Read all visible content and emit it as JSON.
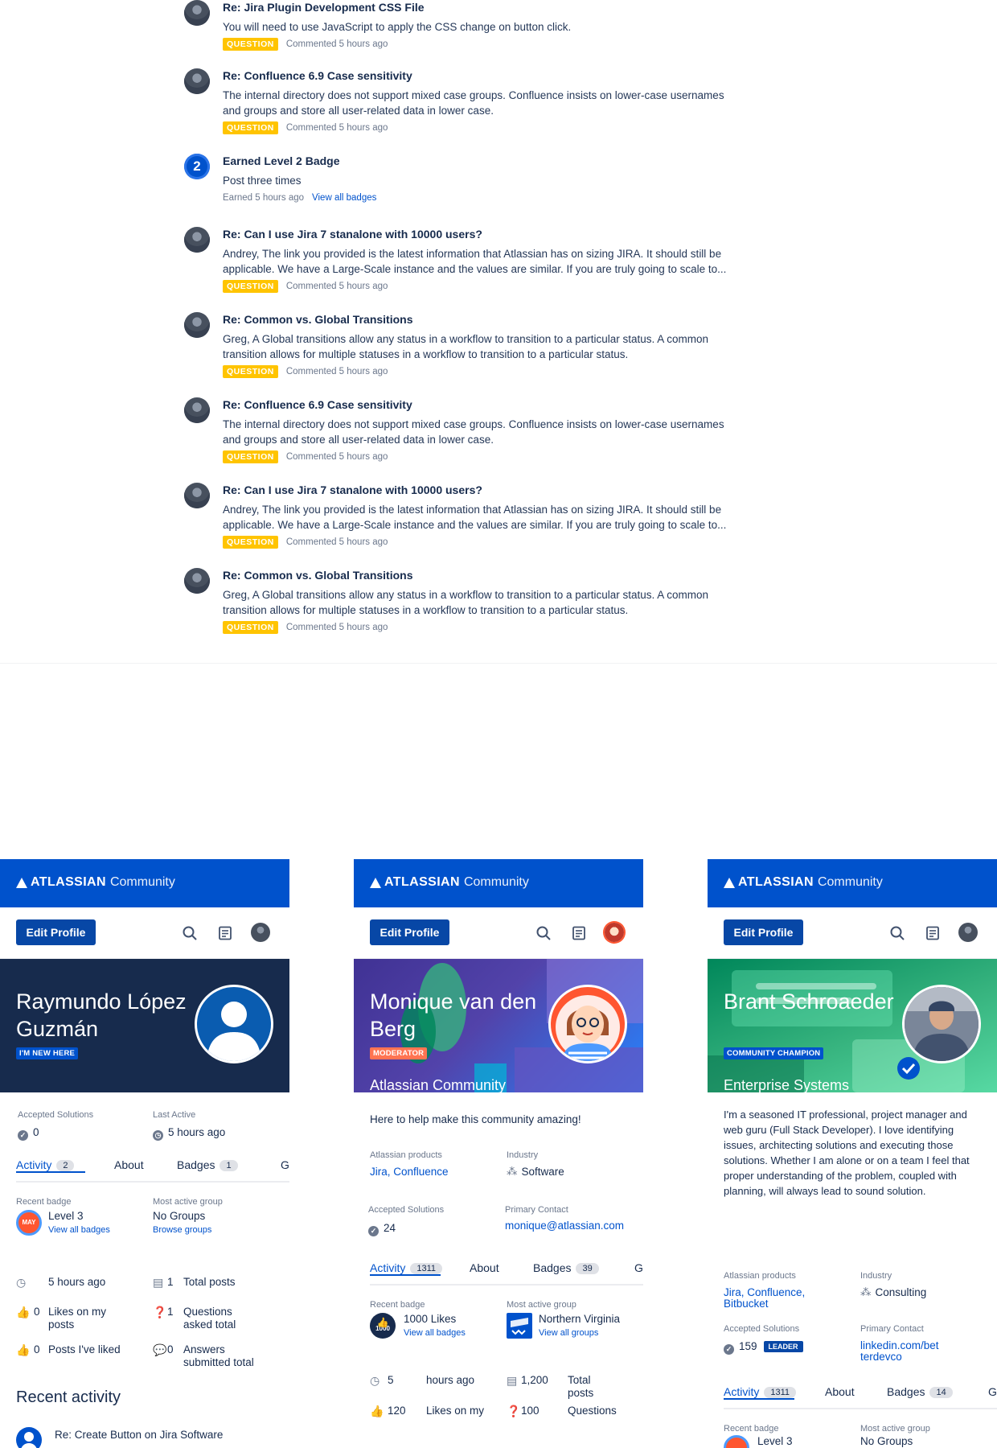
{
  "feed": [
    {
      "type": "comment",
      "title": "Re: Jira Plugin Development CSS File",
      "body": "You will need to use JavaScript to apply the CSS change on button click.",
      "badge": "QUESTION",
      "meta": "Commented 5 hours ago"
    },
    {
      "type": "comment",
      "title": "Re: Confluence 6.9 Case sensitivity",
      "body": "The internal directory does not support mixed case groups.  Confluence insists on lower-case usernames and groups and store all user-related data in lower case.",
      "badge": "QUESTION",
      "meta": "Commented 5 hours ago"
    },
    {
      "type": "badge",
      "title": "Earned Level 2 Badge",
      "body": "Post three times",
      "badge_number": "2",
      "meta": "Earned 5 hours ago",
      "link": "View all badges"
    },
    {
      "type": "comment",
      "title": "Re: Can I use Jira 7 stanalone with 10000 users?",
      "body": "Andrey, The link you provided is the latest information that Atlassian has on sizing JIRA.  It should still be applicable.  We have a Large-Scale instance and the values are similar.  If you are truly going to scale to...",
      "badge": "QUESTION",
      "meta": "Commented 5 hours ago"
    },
    {
      "type": "comment",
      "title": "Re: Common vs. Global Transitions",
      "body": "Greg, A Global transitions allow any status in a workflow to transition to a particular status. A common transition allows for multiple statuses in a workflow to transition to a particular status.",
      "badge": "QUESTION",
      "meta": "Commented 5 hours ago"
    },
    {
      "type": "comment",
      "title": "Re: Confluence 6.9 Case sensitivity",
      "body": "The internal directory does not support mixed case groups.  Confluence insists on lower-case usernames and groups and store all user-related data in lower case.",
      "badge": "QUESTION",
      "meta": "Commented 5 hours ago"
    },
    {
      "type": "comment",
      "title": "Re: Can I use Jira 7 stanalone with 10000 users?",
      "body": "Andrey, The link you provided is the latest information that Atlassian has on sizing JIRA.  It should still be applicable.  We have a Large-Scale instance and the values are similar.  If you are truly going to scale to...",
      "badge": "QUESTION",
      "meta": "Commented 5 hours ago"
    },
    {
      "type": "comment",
      "title": "Re: Common vs. Global Transitions",
      "body": "Greg, A Global transitions allow any status in a workflow to transition to a particular status. A common transition allows for multiple statuses in a workflow to transition to a particular status.",
      "badge": "QUESTION",
      "meta": "Commented 5 hours ago"
    }
  ],
  "colors": {
    "brand": "#0052cc",
    "question": "#ffc400",
    "hero1": "#172b4d",
    "hero2": "#403294",
    "hero3": "#00875a"
  },
  "common": {
    "logo_bold": "ATLASSIAN",
    "logo_word": "Community",
    "edit_profile": "Edit Profile",
    "tab_activity": "Activity",
    "tab_about": "About",
    "tab_badges": "Badges",
    "tab_more": "G"
  },
  "card1": {
    "name": "Raymundo López Guzmán",
    "tag": "I'M NEW HERE",
    "accepted_label": "Accepted Solutions",
    "accepted_value": "0",
    "last_active_label": "Last Active",
    "last_active_value": "5 hours ago",
    "activity_count": "2",
    "badges_count": "1",
    "recent_badge_label": "Recent badge",
    "recent_badge_value": "Level 3",
    "recent_badge_icon_text": "MAY",
    "view_badges": "View all badges",
    "group_label": "Most active group",
    "group_value": "No Groups",
    "browse_groups": "Browse groups",
    "stats": {
      "time": "5 hours ago",
      "total_posts_num": "1",
      "total_posts": "Total posts",
      "likes_num": "0",
      "likes": "Likes on my posts",
      "questions_num": "1",
      "questions": "Questions asked total",
      "liked_num": "0",
      "liked": "Posts I've liked",
      "answers_num": "0",
      "answers": "Answers submitted total"
    },
    "recent_activity_title": "Recent activity",
    "recent_activity_item": "Re: Create Button on Jira Software"
  },
  "card2": {
    "name": "Monique van den Berg",
    "tag": "MODERATOR",
    "role": "Atlassian Community Manager",
    "tagline": "Here to help make this community amazing!",
    "products_label": "Atlassian products",
    "products_value": "Jira, Confluence",
    "industry_label": "Industry",
    "industry_value": "Software",
    "accepted_label": "Accepted Solutions",
    "accepted_value": "24",
    "contact_label": "Primary Contact",
    "contact_value": "monique@atlassian.com",
    "activity_count": "1311",
    "badges_count": "39",
    "recent_badge_label": "Recent badge",
    "recent_badge_value": "1000 Likes",
    "recent_badge_icon_text": "1000",
    "view_badges": "View all badges",
    "group_label": "Most active group",
    "group_value": "Northern Virginia",
    "view_groups": "View all groups",
    "stats": {
      "num1": "5",
      "txt1": "hours ago",
      "num2": "1,200",
      "txt2": "Total posts",
      "num3": "120",
      "txt3": "Likes on my",
      "num4": "100",
      "txt4": "Questions"
    }
  },
  "card3": {
    "name": "Brant Schroaeder",
    "tag": "COMMUNITY CHAMPION",
    "role": "Enterprise Systems Project Manager",
    "bio": "I'm a seasoned IT professional, project manager and web guru (Full Stack Developer). I love identifying issues, architecting solutions and executing those solutions. Whether I am alone or on a team I feel that proper understanding of the problem, coupled with planning, will always lead to sound solution.",
    "products_label": "Atlassian products",
    "products_value": "Jira, Confluence, Bitbucket",
    "industry_label": "Industry",
    "industry_value": "Consulting",
    "accepted_label": "Accepted Solutions",
    "accepted_value": "159",
    "leader": "LEADER",
    "contact_label": "Primary Contact",
    "contact_value": "linkedin.com/betterdevco",
    "activity_count": "1311",
    "badges_count": "14",
    "recent_badge_label": "Recent badge",
    "recent_badge_value": "Level 3",
    "group_label": "Most active group",
    "group_value": "No Groups"
  }
}
